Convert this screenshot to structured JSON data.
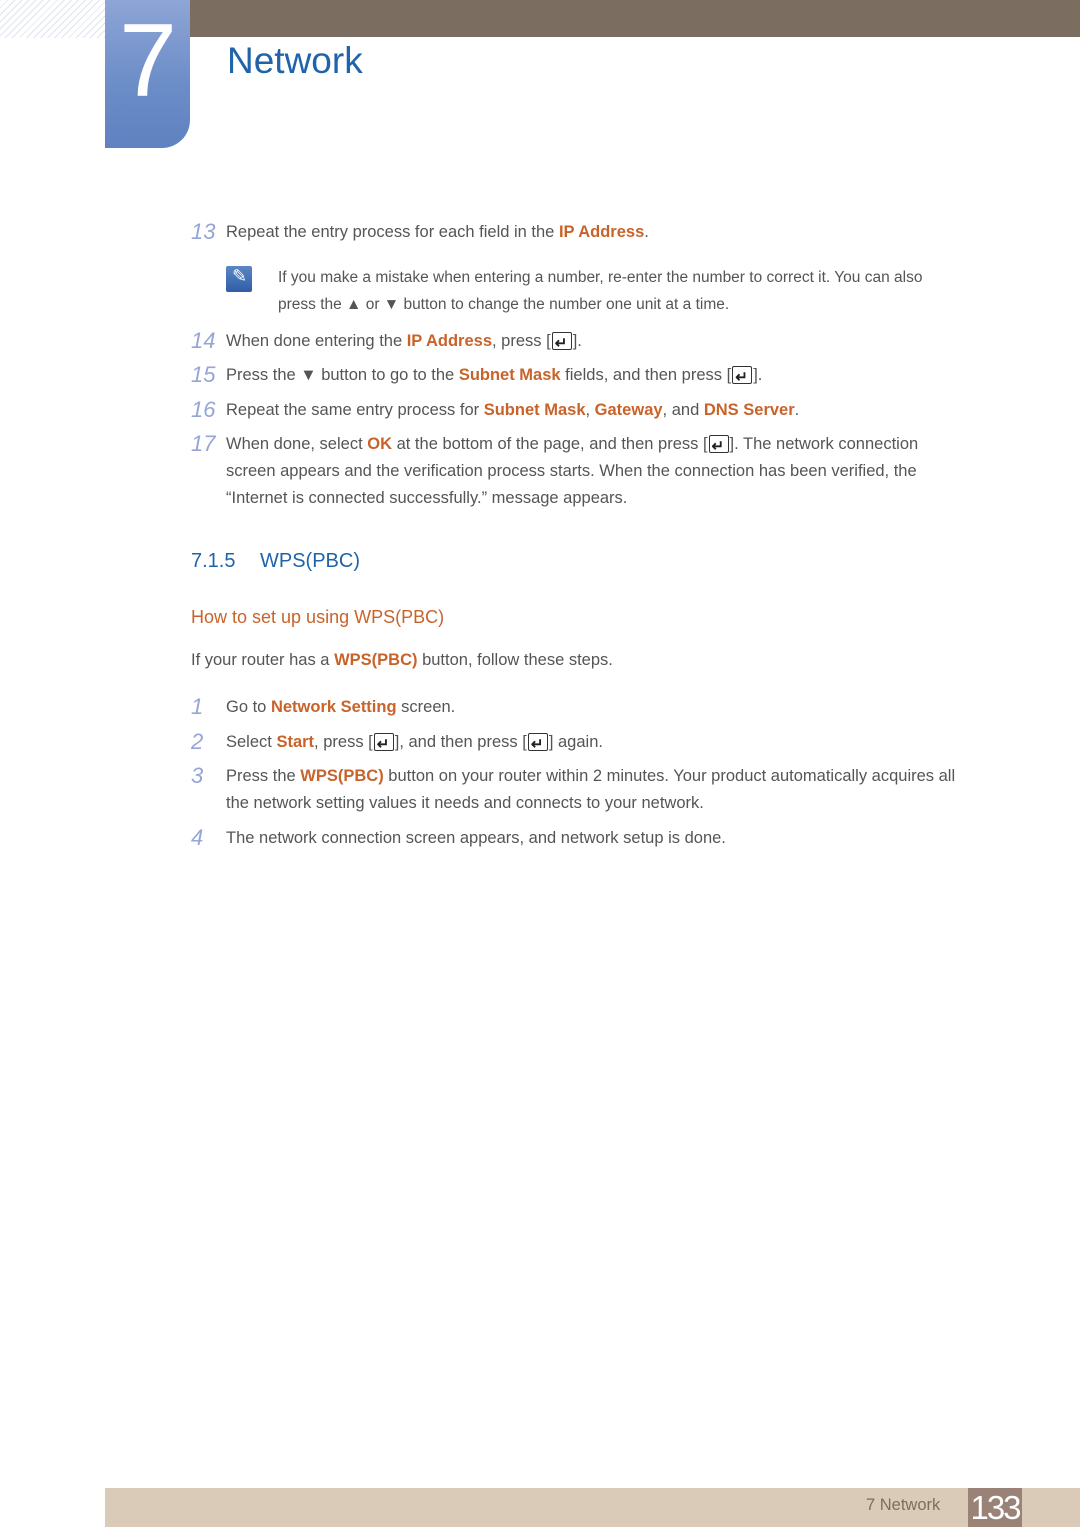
{
  "chapter": {
    "number": "7",
    "title": "Network"
  },
  "steps_top": [
    {
      "num": "13",
      "parts": [
        {
          "t": "Repeat the entry process for each field in the "
        },
        {
          "t": "IP Address",
          "hl": true
        },
        {
          "t": "."
        }
      ]
    },
    {
      "num": "14",
      "parts": [
        {
          "t": "When done entering the "
        },
        {
          "t": "IP Address",
          "hl": true
        },
        {
          "t": ", press ["
        },
        {
          "icon": "enter"
        },
        {
          "t": "]."
        }
      ]
    },
    {
      "num": "15",
      "parts": [
        {
          "t": "Press the ▼ button to go to the "
        },
        {
          "t": "Subnet Mask",
          "hl": true
        },
        {
          "t": " fields, and then press ["
        },
        {
          "icon": "enter"
        },
        {
          "t": "]."
        }
      ]
    },
    {
      "num": "16",
      "parts": [
        {
          "t": "Repeat the same entry process for "
        },
        {
          "t": "Subnet Mask",
          "hl": true
        },
        {
          "t": ", "
        },
        {
          "t": "Gateway",
          "hl": true
        },
        {
          "t": ", and "
        },
        {
          "t": "DNS Server",
          "hl": true
        },
        {
          "t": "."
        }
      ]
    },
    {
      "num": "17",
      "parts": [
        {
          "t": "When done, select "
        },
        {
          "t": "OK",
          "hl": true
        },
        {
          "t": " at the bottom of the page, and then press ["
        },
        {
          "icon": "enter"
        },
        {
          "t": "]. The network connection"
        }
      ],
      "continuation": [
        "screen appears and the verification process starts. When the connection has been verified, the",
        "“Internet is connected successfully.” message appears."
      ]
    }
  ],
  "note": {
    "icon": "note-pencil-icon",
    "lines": [
      "If you make a mistake when entering a number, re-enter the number to correct it. You can also",
      "press the ▲ or ▼ button to change the number one unit at a time."
    ]
  },
  "section": {
    "number": "7.1.5",
    "title": "WPS(PBC)"
  },
  "subheading": "How to set up using WPS(PBC)",
  "intro": [
    {
      "t": "If your router has a "
    },
    {
      "t": "WPS(PBC)",
      "hl": true
    },
    {
      "t": " button, follow these steps."
    }
  ],
  "steps_wps": [
    {
      "num": "1",
      "parts": [
        {
          "t": "Go to "
        },
        {
          "t": "Network Setting",
          "hl": true
        },
        {
          "t": " screen."
        }
      ]
    },
    {
      "num": "2",
      "parts": [
        {
          "t": "Select "
        },
        {
          "t": "Start",
          "hl": true
        },
        {
          "t": ", press ["
        },
        {
          "icon": "enter"
        },
        {
          "t": "], and then press ["
        },
        {
          "icon": "enter"
        },
        {
          "t": "] again."
        }
      ]
    },
    {
      "num": "3",
      "parts": [
        {
          "t": "Press the "
        },
        {
          "t": "WPS(PBC)",
          "hl": true
        },
        {
          "t": " button on your router within 2 minutes. Your product automatically acquires all"
        }
      ],
      "continuation": [
        "the network setting values it needs and connects to your network."
      ]
    },
    {
      "num": "4",
      "parts": [
        {
          "t": "The network connection screen appears, and network setup is done."
        }
      ]
    }
  ],
  "footer": {
    "label": "7 Network",
    "page": "133"
  },
  "colors": {
    "accent_blue": "#1f63aa",
    "highlight_orange": "#c8632a",
    "step_number": "#95a5d6",
    "top_bar": "#7b6e60",
    "footer_bar": "#d9cbb7",
    "page_box": "#9b8277"
  }
}
